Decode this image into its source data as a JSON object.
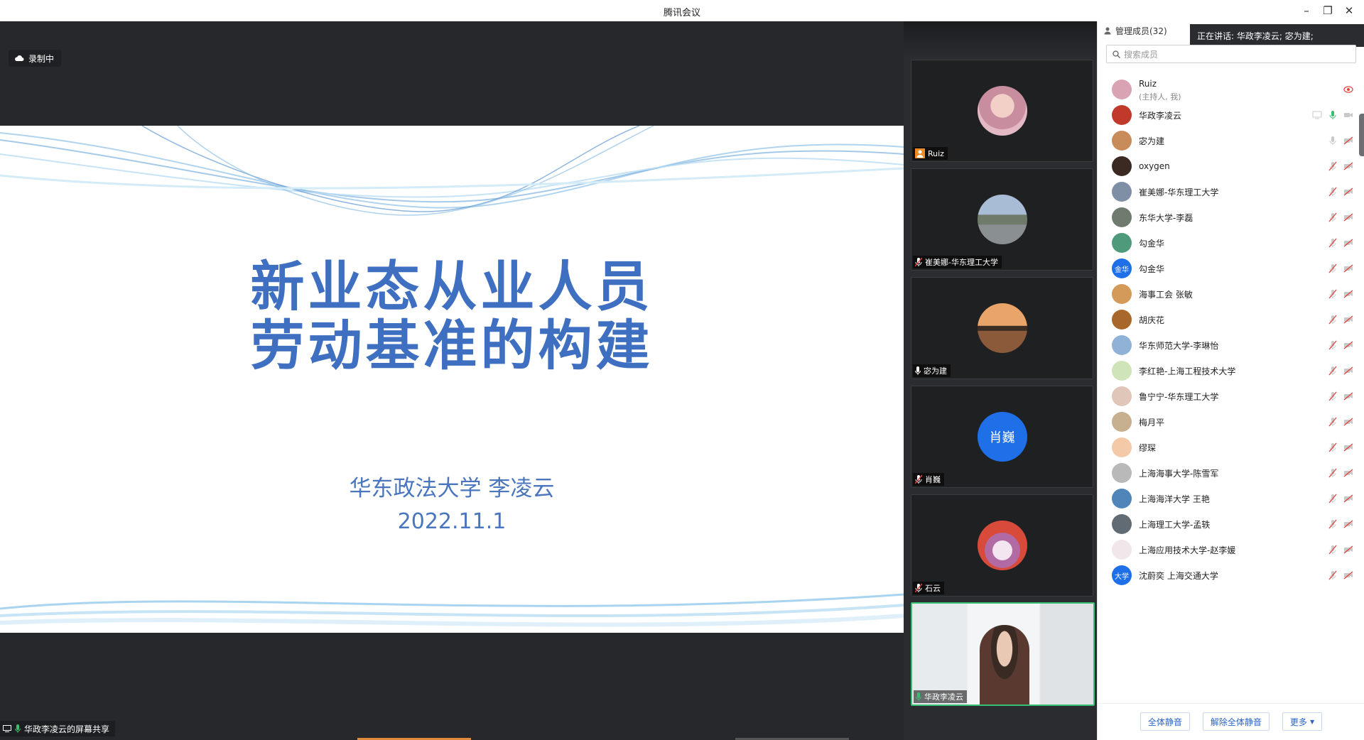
{
  "window": {
    "title": "腾讯会议"
  },
  "recording": {
    "label": "录制中"
  },
  "slide": {
    "title_line1": "新业态从业人员",
    "title_line2": "劳动基准的构建",
    "author": "华东政法大学 李凌云",
    "date": "2022.11.1"
  },
  "share": {
    "label": "华政李凌云的屏幕共享"
  },
  "video_tiles": [
    {
      "name": "Ruiz",
      "badge": "host-icon"
    },
    {
      "name": "崔美娜-华东理工大学",
      "badge": "mic-muted-icon"
    },
    {
      "name": "宓为建",
      "badge": "mic-icon"
    },
    {
      "name": "肖巍",
      "badge": "mic-muted-icon",
      "avatar_text": "肖巍"
    },
    {
      "name": "石云",
      "badge": "mic-muted-icon"
    },
    {
      "name": "华政李凌云",
      "badge": "mic-active-icon"
    }
  ],
  "panel": {
    "header": "管理成员(32)",
    "speaking": "正在讲话: 华政李凌云; 宓为建;",
    "search_placeholder": "搜索成员",
    "members": [
      {
        "name": "Ruiz",
        "sub": "(主持人, 我)",
        "color": "#d9a3b4"
      },
      {
        "name": "华政李凌云",
        "color": "#c0392b"
      },
      {
        "name": "宓为建",
        "color": "#c88b5a"
      },
      {
        "name": "oxygen",
        "color": "#3a2a22"
      },
      {
        "name": "崔美娜-华东理工大学",
        "color": "#7f8fa6"
      },
      {
        "name": "东华大学-李磊",
        "color": "#6f7b6f"
      },
      {
        "name": "勾金华",
        "color": "#4f9a7a"
      },
      {
        "name": "勾金华",
        "color": "#1e6fe8",
        "avatar_text": "金华"
      },
      {
        "name": "海事工会  张敏",
        "color": "#d39a5a"
      },
      {
        "name": "胡庆花",
        "color": "#a8682c"
      },
      {
        "name": "华东师范大学-李琳怡",
        "color": "#8fb2d6"
      },
      {
        "name": "李红艳-上海工程技术大学",
        "color": "#cfe4b8"
      },
      {
        "name": "鲁宁宁-华东理工大学",
        "color": "#e0c6b8"
      },
      {
        "name": "梅月平",
        "color": "#c7b090"
      },
      {
        "name": "缪琛",
        "color": "#f4c9a8"
      },
      {
        "name": "上海海事大学-陈雪军",
        "color": "#b9b9b9"
      },
      {
        "name": "上海海洋大学 王艳",
        "color": "#4f85b8"
      },
      {
        "name": "上海理工大学-孟轶",
        "color": "#616b73"
      },
      {
        "name": "上海应用技术大学-赵李媛",
        "color": "#f1e6ea"
      },
      {
        "name": "沈蔚奕 上海交通大学",
        "color": "#1e6fe8",
        "avatar_text": "大学"
      }
    ],
    "footer": {
      "mute_all": "全体静音",
      "unmute_all": "解除全体静音",
      "more": "更多"
    }
  }
}
